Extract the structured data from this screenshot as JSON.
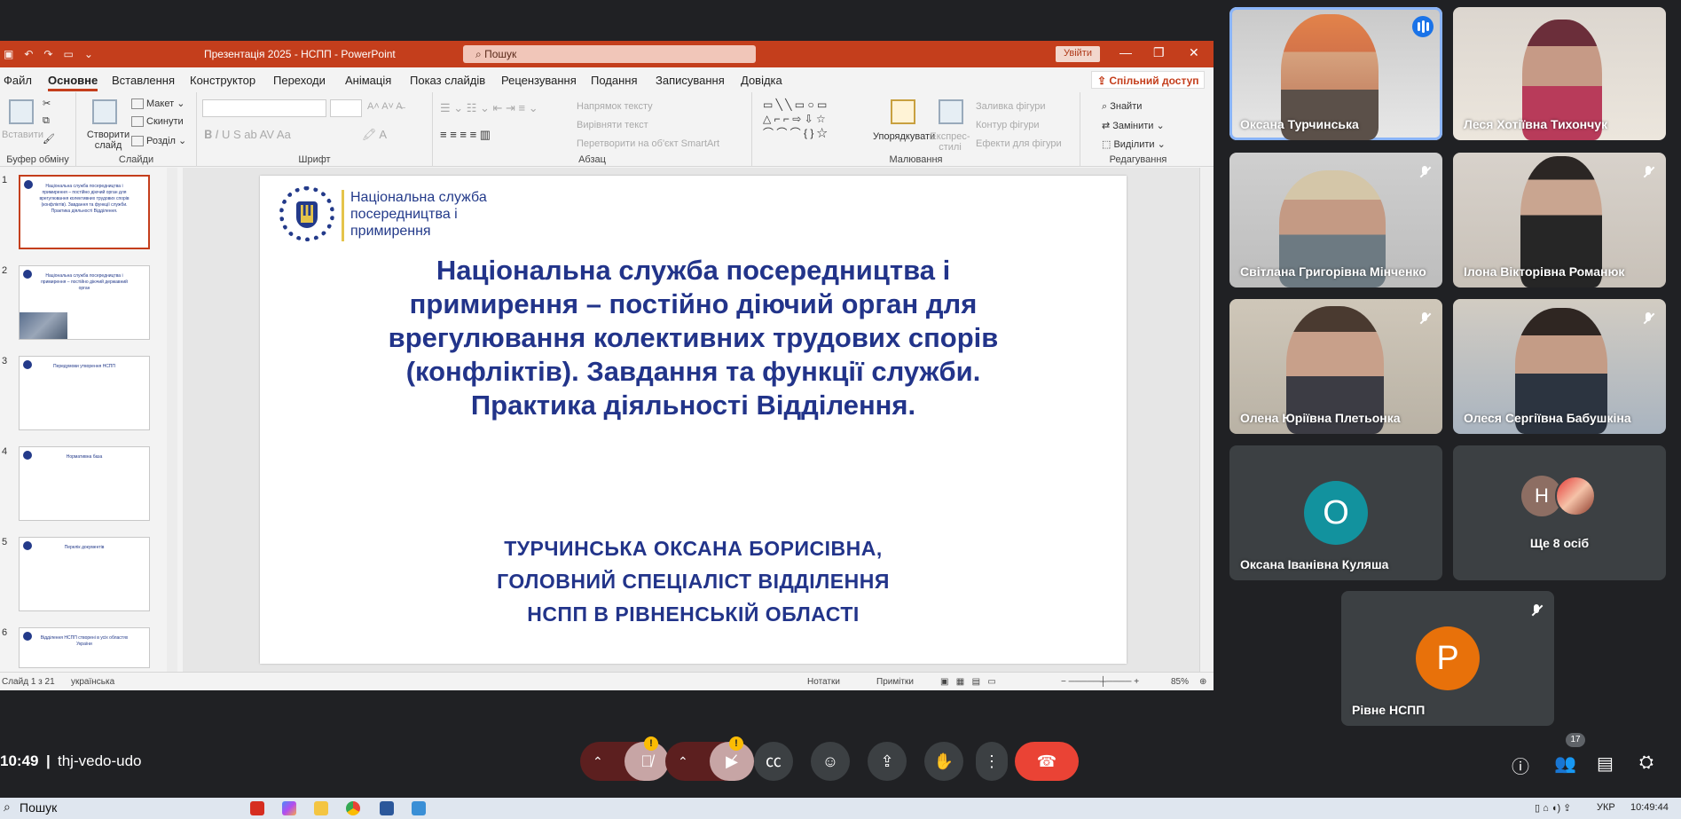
{
  "ppt": {
    "window_title": "Презентація 2025 - НСПП - PowerPoint",
    "search_placeholder": "Пошук",
    "signin": "Увійти",
    "share": "Спільний доступ",
    "tabs": [
      "Файл",
      "Основне",
      "Вставлення",
      "Конструктор",
      "Переходи",
      "Анімація",
      "Показ слайдів",
      "Рецензування",
      "Подання",
      "Записування",
      "Довідка"
    ],
    "active_tab": "Основне",
    "ribbon": {
      "clipboard": {
        "label": "Буфер обміну",
        "paste": "Вставити"
      },
      "slides": {
        "label": "Слайди",
        "new_slide": "Створити слайд",
        "layout": "Макет",
        "reset": "Скинути",
        "section": "Розділ"
      },
      "font": {
        "label": "Шрифт"
      },
      "paragraph": {
        "label": "Абзац",
        "text_direction": "Напрямок тексту",
        "align_text": "Вирівняти текст",
        "smartart": "Перетворити на об'єкт SmartArt"
      },
      "drawing": {
        "label": "Малювання",
        "arrange": "Упорядкувати",
        "quick_styles": "Експрес-стилі",
        "shape_fill": "Заливка фігури",
        "shape_outline": "Контур фігури",
        "shape_effects": "Ефекти для фігури"
      },
      "editing": {
        "label": "Редагування",
        "find": "Знайти",
        "replace": "Замінити",
        "select": "Виділити"
      }
    },
    "thumbs": [
      {
        "num": "1",
        "text": "Національна служба посередництва і примирення – постійно діючий орган для врегулювання колективних трудових спорів (конфліктів). Завдання та функції служби. Практика діяльності Відділення."
      },
      {
        "num": "2",
        "text": "Національна служба посередництва і примирення – постійно діючий державний орган"
      },
      {
        "num": "3",
        "text": "Передумови утворення НСПП"
      },
      {
        "num": "4",
        "text": "Нормативна база"
      },
      {
        "num": "5",
        "text": "Перелік документів"
      },
      {
        "num": "6",
        "text": "Відділення НСПП створені в усіх областях України"
      }
    ],
    "slide": {
      "logo_text": "Національна служба посередництва і примирення",
      "title": "Національна служба посередництва і примирення – постійно діючий орган для врегулювання колективних трудових спорів (конфліктів). Завдання та функції служби. Практика діяльності Відділення.",
      "sub1": "ТУРЧИНСЬКА ОКСАНА БОРИСІВНА,",
      "sub2": "ГОЛОВНИЙ СПЕЦІАЛІСТ ВІДДІЛЕННЯ",
      "sub3": "НСПП В РІВНЕНСЬКІЙ ОБЛАСТІ"
    },
    "status": {
      "slide": "Слайд 1 з 21",
      "lang": "українська",
      "notes": "Нотатки",
      "comments": "Примітки",
      "zoom": "85%"
    }
  },
  "meet": {
    "participants": [
      {
        "name": "Оксана Турчинська"
      },
      {
        "name": "Леся Хотіївна Тихончук"
      },
      {
        "name": "Світлана Григорівна Мінченко"
      },
      {
        "name": "Ілона Вікторівна Романюк"
      },
      {
        "name": "Олена Юріївна Плетьонка"
      },
      {
        "name": "Олеся Сергіївна Бабушкіна"
      },
      {
        "name": "Оксана Іванівна Куляша",
        "initial": "О"
      },
      {
        "name": "Ще 8 осіб",
        "initial": "Н"
      },
      {
        "name": "Рівне НСПП",
        "initial": "Р"
      }
    ],
    "time": "10:49",
    "code": "thj-vedo-udo",
    "participants_count": "17"
  },
  "taskbar": {
    "search": "Пошук",
    "lang": "УКР",
    "time": "10:49:44"
  },
  "colors": {
    "ppt_accent": "#c43e1c",
    "slide_text": "#22348a",
    "meet_bg": "#202124",
    "hangup": "#ea4335"
  }
}
